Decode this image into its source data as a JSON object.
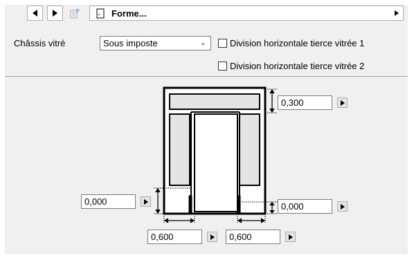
{
  "toolbar": {
    "back_label": "Back",
    "forward_label": "Forward",
    "title": "Forme..."
  },
  "form": {
    "frame_label": "Châssis vitré",
    "frame_value": "Sous imposte",
    "checkbox1_label": "Division horizontale tierce vitrée 1",
    "checkbox1_checked": false,
    "checkbox2_label": "Division horizontale tierce vitrée 2",
    "checkbox2_checked": false
  },
  "dimensions": {
    "top_height": "0,300",
    "left_offset": "0,000",
    "right_offset": "0,000",
    "bottom_left_width": "0,600",
    "bottom_right_width": "0,600"
  }
}
